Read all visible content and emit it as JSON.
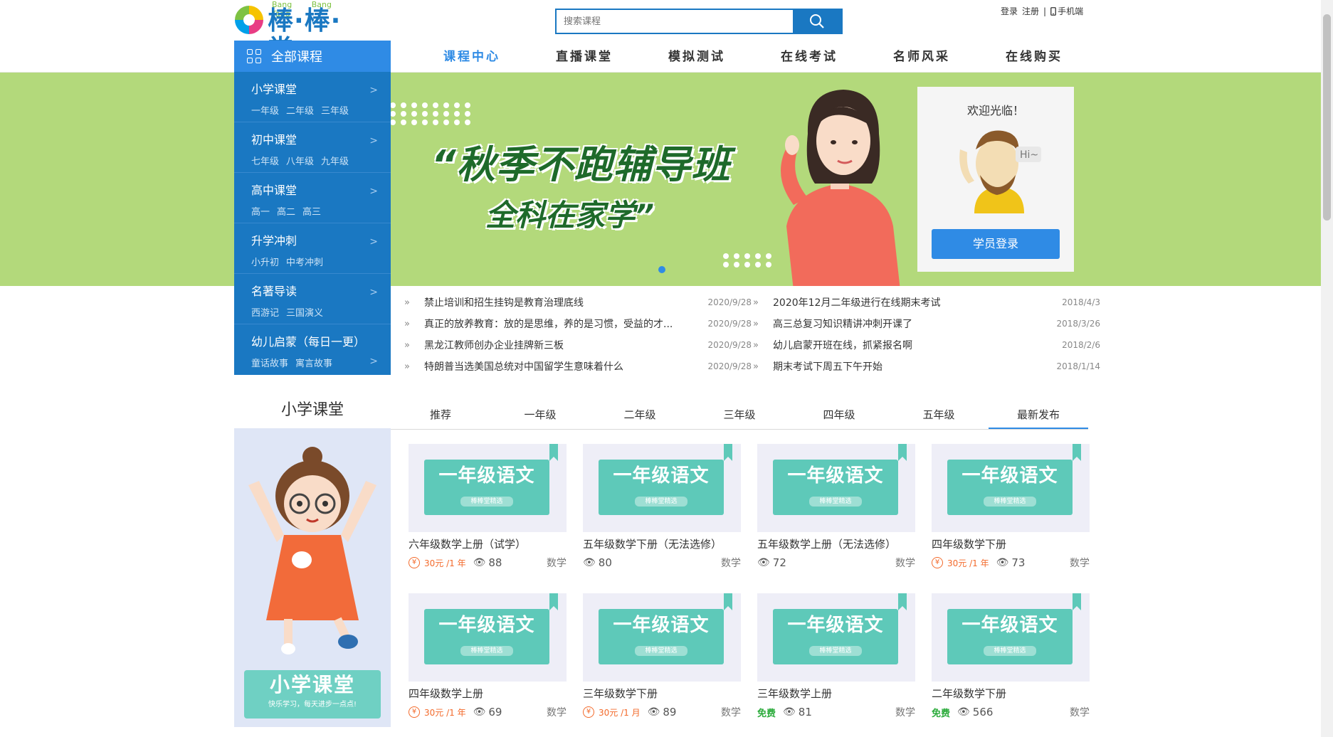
{
  "header": {
    "logo_text": "棒·棒·堂",
    "logo_pinyin": "Bang Bang Tang",
    "search_placeholder": "搜索课程",
    "login": "登录",
    "register": "注册",
    "mobile": "手机端"
  },
  "nav": {
    "all_courses": "全部课程",
    "items": [
      "课程中心",
      "直播课堂",
      "模拟测试",
      "在线考试",
      "名师风采",
      "在线购买"
    ]
  },
  "banner": {
    "slogan1": "“秋季不跑辅导班",
    "slogan2": "全科在家学”",
    "welcome": "欢迎光临！",
    "hi": "Hi~",
    "login_button": "学员登录"
  },
  "sidebar": {
    "categories": [
      {
        "title": "小学课堂",
        "subs": [
          "一年级",
          "二年级",
          "三年级"
        ]
      },
      {
        "title": "初中课堂",
        "subs": [
          "七年级",
          "八年级",
          "九年级"
        ]
      },
      {
        "title": "高中课堂",
        "subs": [
          "高一",
          "高二",
          "高三"
        ]
      },
      {
        "title": "升学冲刺",
        "subs": [
          "小升初",
          "中考冲刺"
        ]
      },
      {
        "title": "名著导读",
        "subs": [
          "西游记",
          "三国演义"
        ]
      },
      {
        "title": "幼儿启蒙（每日一更）",
        "subs": [
          "童话故事",
          "寓言故事"
        ]
      }
    ]
  },
  "news_left": [
    {
      "title": "禁止培训和招生挂钩是教育治理底线",
      "date": "2020/9/28"
    },
    {
      "title": "真正的放养教育：放的是思维，养的是习惯，受益的才...",
      "date": "2020/9/28"
    },
    {
      "title": "黑龙江教师创办企业挂牌新三板",
      "date": "2020/9/28"
    },
    {
      "title": "特朗普当选美国总统对中国留学生意味着什么",
      "date": "2020/9/28"
    }
  ],
  "news_right": [
    {
      "title": "2020年12月二年级进行在线期末考试",
      "date": "2018/4/3"
    },
    {
      "title": "高三总复习知识精讲冲刺开课了",
      "date": "2018/3/26"
    },
    {
      "title": "幼儿启蒙开班在线，抓紧报名啊",
      "date": "2018/2/6"
    },
    {
      "title": "期末考试下周五下午开始",
      "date": "2018/1/14"
    }
  ],
  "section": {
    "title": "小学课堂",
    "tabs": [
      "推荐",
      "一年级",
      "二年级",
      "三年级",
      "四年级",
      "五年级",
      "最新发布"
    ],
    "active_tab": "最新发布",
    "badge_title": "小学课堂",
    "badge_sub": "快乐学习，每天进步一点点!"
  },
  "card_thumb": {
    "title": "一年级语文",
    "sub": "棒棒堂精选"
  },
  "cards": [
    {
      "title": "六年级数学上册（试学）",
      "price": "30元 /1 年",
      "views": "88",
      "subject": "数学",
      "free": ""
    },
    {
      "title": "五年级数学下册（无法选修）",
      "price": "",
      "views": "80",
      "subject": "数学",
      "free": ""
    },
    {
      "title": "五年级数学上册（无法选修）",
      "price": "",
      "views": "72",
      "subject": "数学",
      "free": ""
    },
    {
      "title": "四年级数学下册",
      "price": "30元 /1 年",
      "views": "73",
      "subject": "数学",
      "free": ""
    },
    {
      "title": "四年级数学上册",
      "price": "30元 /1 年",
      "views": "69",
      "subject": "数学",
      "free": ""
    },
    {
      "title": "三年级数学下册",
      "price": "30元 /1 月",
      "views": "89",
      "subject": "数学",
      "free": ""
    },
    {
      "title": "三年级数学上册",
      "price": "",
      "views": "81",
      "subject": "数学",
      "free": "免费"
    },
    {
      "title": "二年级数学下册",
      "price": "",
      "views": "566",
      "subject": "数学",
      "free": "免费"
    }
  ],
  "colors": {
    "primary": "#1a78c2",
    "accent": "#2f8be5",
    "banner_bg": "#b3d97b",
    "price": "#f36a2b",
    "free": "#2bab3b"
  }
}
